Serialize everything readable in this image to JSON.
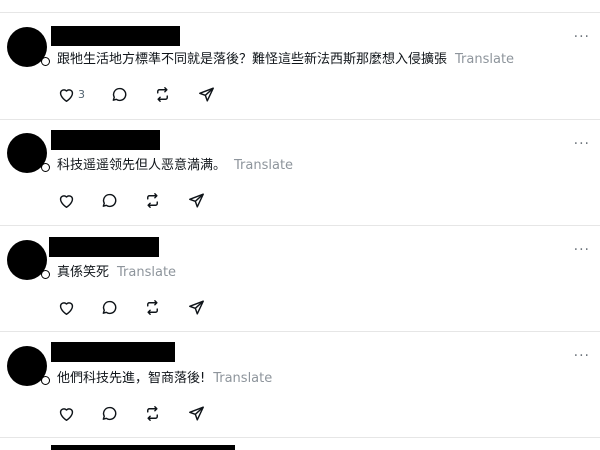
{
  "translate_label": "Translate",
  "more_label": "···",
  "posts": [
    {
      "text": "跟牠生活地方標準不同就是落後？難怪這些新法西斯那麼想入侵擴張",
      "like_count": "3"
    },
    {
      "text": "科技遥遥领先但人恶意満满。",
      "like_count": ""
    },
    {
      "text": "真係笑死",
      "like_count": ""
    },
    {
      "text": "他們科技先進，智商落後!",
      "like_count": ""
    }
  ]
}
